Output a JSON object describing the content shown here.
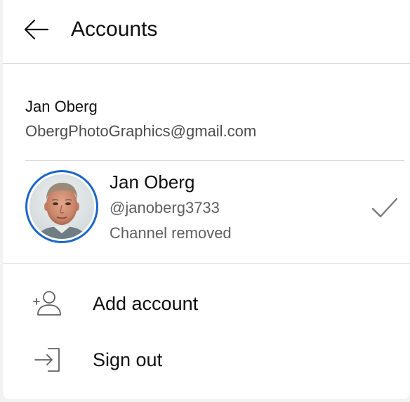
{
  "header": {
    "title": "Accounts",
    "back_icon": "arrow-left-icon"
  },
  "google_account": {
    "name": "Jan Oberg",
    "email": "ObergPhotoGraphics@gmail.com"
  },
  "channel": {
    "name": "Jan Oberg",
    "handle": "@janoberg3733",
    "status": "Channel removed",
    "selected": true,
    "avatar_border_color": "#1b66c9"
  },
  "menu": {
    "items": [
      {
        "label": "Add account",
        "icon": "add-person-icon"
      },
      {
        "label": "Sign out",
        "icon": "sign-out-icon"
      }
    ]
  }
}
